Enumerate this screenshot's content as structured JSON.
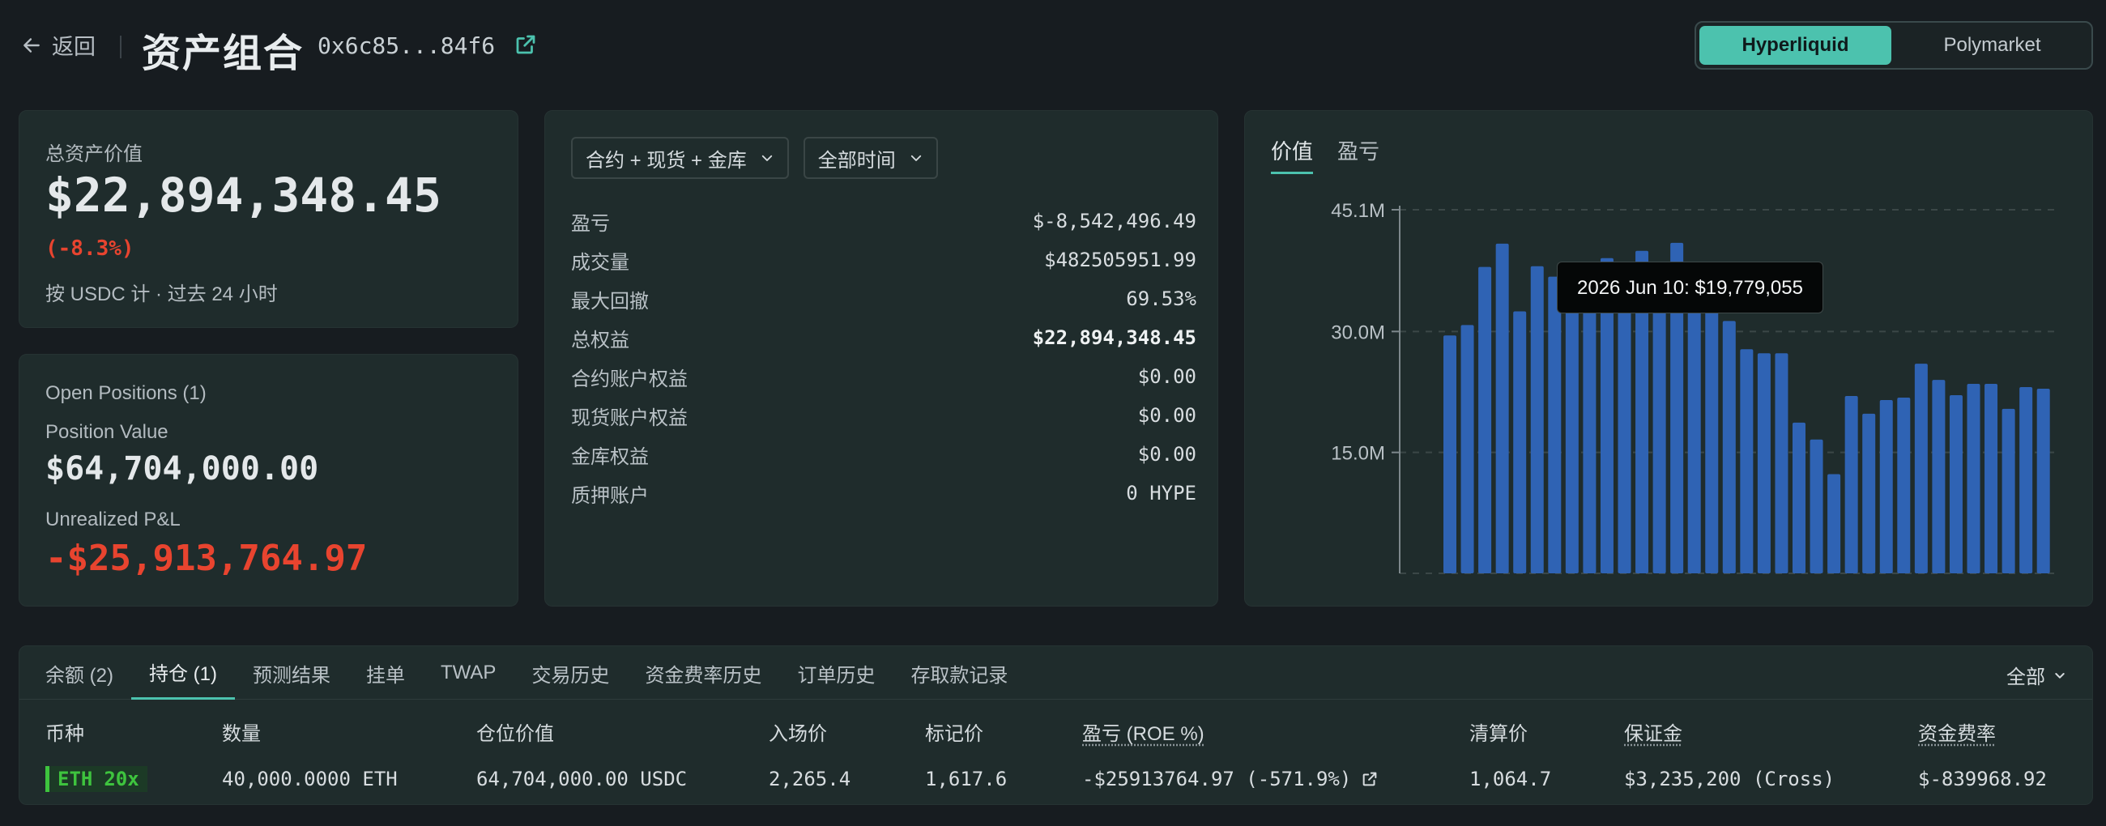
{
  "header": {
    "back_label": "返回",
    "title": "资产组合",
    "address": "0x6c85...84f6",
    "segments": [
      "Hyperliquid",
      "Polymarket"
    ],
    "active_segment": "Hyperliquid"
  },
  "total_card": {
    "label": "总资产价值",
    "value": "$22,894,348.45",
    "change": "(-8.3%)",
    "note": "按 USDC 计 · 过去 24 小时"
  },
  "positions_card": {
    "title": "Open Positions (1)",
    "position_value_label": "Position Value",
    "position_value": "$64,704,000.00",
    "upnl_label": "Unrealized P&L",
    "upnl": "-$25,913,764.97"
  },
  "stats_card": {
    "account_filter": "合约 + 现货 + 金库",
    "time_filter": "全部时间",
    "rows": [
      {
        "key": "盈亏",
        "value": "$-8,542,496.49"
      },
      {
        "key": "成交量",
        "value": "$482505951.99"
      },
      {
        "key": "最大回撤",
        "value": "69.53%"
      },
      {
        "key": "总权益",
        "value": "$22,894,348.45"
      },
      {
        "key": "合约账户权益",
        "value": "$0.00"
      },
      {
        "key": "现货账户权益",
        "value": "$0.00"
      },
      {
        "key": "金库权益",
        "value": "$0.00"
      },
      {
        "key": "质押账户",
        "value": "0 HYPE"
      }
    ]
  },
  "chart_card": {
    "tabs": [
      "价值",
      "盈亏"
    ],
    "active_tab": "价值",
    "tooltip": "2026 Jun 10: $19,779,055"
  },
  "chart_data": {
    "type": "bar",
    "ytick_labels": [
      "45.1M",
      "30.0M",
      "15.0M"
    ],
    "ytick_values": [
      45.1,
      30.0,
      15.0
    ],
    "ylim": [
      0,
      45.1
    ],
    "grid": true,
    "bar_color": "#2f63b4",
    "values": [
      29.5,
      30.8,
      38.0,
      40.9,
      32.5,
      38.1,
      36.8,
      38.5,
      38.2,
      39.1,
      38.3,
      40.0,
      37.0,
      41.0,
      38.2,
      36.1,
      31.3,
      27.8,
      27.3,
      27.3,
      18.7,
      16.6,
      12.3,
      22.0,
      19.8,
      21.5,
      21.8,
      26.0,
      24.0,
      22.1,
      23.5,
      23.5,
      20.4,
      23.1,
      22.9
    ],
    "value_unit": "M USD"
  },
  "bottom": {
    "tabs": [
      "余额 (2)",
      "持仓 (1)",
      "预测结果",
      "挂单",
      "TWAP",
      "交易历史",
      "资金费率历史",
      "订单历史",
      "存取款记录"
    ],
    "active_tab": "持仓 (1)",
    "filter": "全部",
    "columns": [
      "币种",
      "数量",
      "仓位价值",
      "入场价",
      "标记价",
      "盈亏 (ROE %)",
      "清算价",
      "保证金",
      "资金费率"
    ],
    "row": {
      "coin": "ETH",
      "leverage": "20x",
      "size": "40,000.0000 ETH",
      "position_value": "64,704,000.00 USDC",
      "entry_price": "2,265.4",
      "mark_price": "1,617.6",
      "pnl": "-$25913764.97 (-571.9%)",
      "liq_price": "1,064.7",
      "margin": "$3,235,200 (Cross)",
      "funding": "$-839968.92"
    }
  },
  "colors": {
    "accent": "#4cc2ae",
    "negative": "#e8442f",
    "positive": "#3ec43e"
  }
}
